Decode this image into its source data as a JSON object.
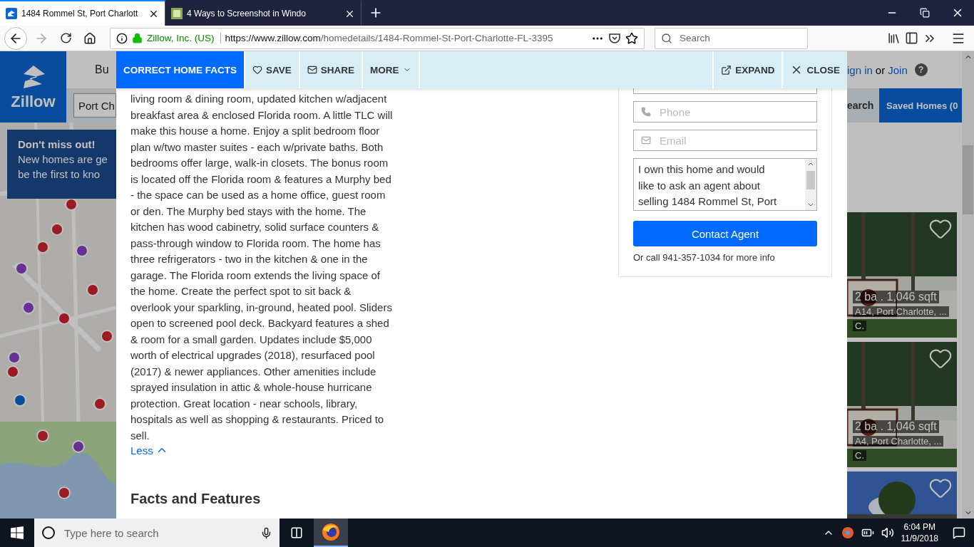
{
  "browser": {
    "tabs": [
      {
        "title": "1484 Rommel St, Port Charlott",
        "kind": "house",
        "selected": true
      },
      {
        "title": "4 Ways to Screenshot in Windo",
        "kind": "wh",
        "selected": false
      }
    ],
    "identity": "Zillow, Inc. (US)",
    "url_host": "https://www.zillow.com",
    "url_path": "/homedetails/1484-Rommel-St-Port-Charlotte-FL-3395",
    "search": {
      "placeholder": "Search"
    }
  },
  "background_page": {
    "logo": "Zillow",
    "nav_item": "Bu",
    "search_value": "Port Ch",
    "banner": {
      "title": "Don't miss out!",
      "lines": [
        "New homes are ge",
        "be the first to kno"
      ]
    },
    "account": {
      "sign_in": "ign in",
      "or": "or",
      "join": "Join",
      "help": "?"
    },
    "search_button": "earch",
    "saved_homes": "Saved Homes (0",
    "listings": [
      {
        "details": "2 ba . 1,046 sqft",
        "address": "A14, Port Charlotte, ...",
        "extra": "C.",
        "kind": "condo"
      },
      {
        "details": "2 ba . 1,046 sqft",
        "address": "A4, Port Charlotte, ...",
        "extra": "C.",
        "kind": "condo"
      },
      {
        "kind": "house"
      }
    ]
  },
  "modal": {
    "actions": [
      {
        "label": "CORRECT HOME FACTS",
        "kind": "primary"
      },
      {
        "label": "SAVE",
        "kind": "save"
      },
      {
        "label": "SHARE",
        "kind": "share"
      },
      {
        "label": "MORE",
        "kind": "more"
      }
    ],
    "window_actions": [
      {
        "label": "EXPAND",
        "kind": "expand"
      },
      {
        "label": "CLOSE",
        "kind": "close"
      }
    ],
    "description": [
      "living room & dining room, updated kitchen w/adjacent",
      "breakfast area & enclosed Florida room. A little TLC will",
      "make this house a home. Enjoy a split bedroom floor",
      "plan w/two master suites - each w/private baths. Both",
      "bedrooms offer large, walk-in closets. The bonus room",
      "is located off the Florida room & features a Murphy bed",
      "- the space can be used as a home office, guest room",
      "or den. The Murphy bed stays with the home. The",
      "kitchen has wood cabinetry, solid surface counters &",
      "pass-through window to Florida room. The home has",
      "three refrigerators - two in the kitchen & one in the",
      "garage. The Florida room extends the living space of",
      "the home. Create the perfect spot to sit back &",
      "overlook your sparkling, in-ground, heated pool. Sliders",
      "open to screened pool deck. Backyard features a shed",
      "& room for a small garden. Updates include $5,000",
      "worth of electrical upgrades (2018), resurfaced pool",
      "(2017) & newer appliances. Other amenities include",
      "sprayed insulation in attic & whole-house hurricane",
      "protection. Great location - near schools, library,",
      "hospitals as well as shopping & restaurants. Priced to",
      "sell."
    ],
    "less_link": "Less",
    "section_heading": "Facts and Features",
    "contact": {
      "phone": {
        "placeholder": "Phone"
      },
      "email": {
        "placeholder": "Email"
      },
      "message": [
        "I own this home and would",
        "like to ask an agent about",
        "selling 1484 Rommel St, Port"
      ],
      "button": "Contact Agent",
      "call_note": "Or call 941-357-1034 for more info"
    }
  },
  "taskbar": {
    "search": {
      "placeholder": "Type here to search"
    },
    "time": "6:04 PM",
    "date": "11/9/2018"
  }
}
